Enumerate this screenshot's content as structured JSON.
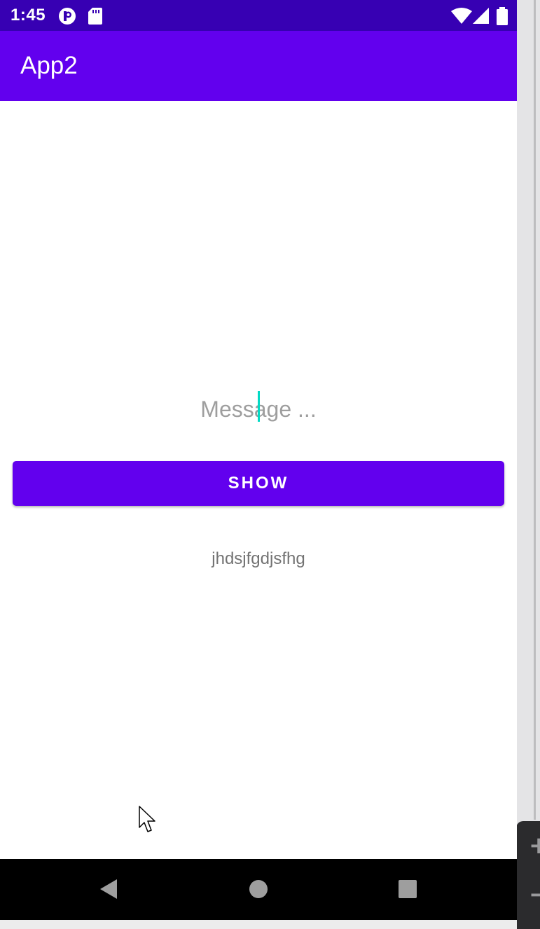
{
  "status_bar": {
    "time": "1:45",
    "left_icons": [
      "p-badge-icon",
      "sd-card-icon"
    ],
    "right_icons": [
      "wifi-icon",
      "cell-signal-icon",
      "battery-icon"
    ],
    "color": "#3700b3"
  },
  "app_bar": {
    "title": "App2",
    "color": "#6200ee"
  },
  "form": {
    "message_placeholder": "Message ...",
    "message_value": "",
    "show_label": "SHOW",
    "output_text": "jhdsjfgdjsfhg",
    "caret_color": "#03dac5"
  },
  "nav_bar": {
    "buttons": [
      "back-icon",
      "home-icon",
      "recents-icon"
    ]
  },
  "emulator": {
    "zoom_in": "+",
    "zoom_out": "−"
  }
}
